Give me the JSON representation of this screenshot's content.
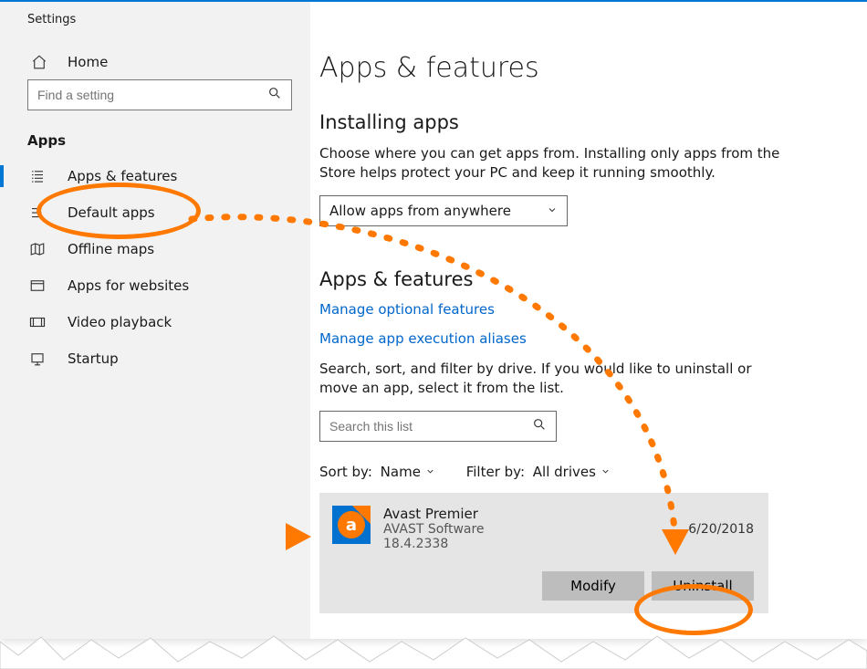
{
  "app_title": "Settings",
  "sidebar": {
    "home_label": "Home",
    "search_placeholder": "Find a setting",
    "section_label": "Apps",
    "items": [
      {
        "label": "Apps & features"
      },
      {
        "label": "Default apps"
      },
      {
        "label": "Offline maps"
      },
      {
        "label": "Apps for websites"
      },
      {
        "label": "Video playback"
      },
      {
        "label": "Startup"
      }
    ]
  },
  "page": {
    "title": "Apps & features",
    "install_section": {
      "title": "Installing apps",
      "desc": "Choose where you can get apps from. Installing only apps from the Store helps protect your PC and keep it running smoothly.",
      "dropdown_value": "Allow apps from anywhere"
    },
    "features_section": {
      "title": "Apps & features",
      "link1": "Manage optional features",
      "link2": "Manage app execution aliases",
      "desc": "Search, sort, and filter by drive. If you would like to uninstall or move an app, select it from the list.",
      "search_placeholder": "Search this list",
      "sort_label": "Sort by:",
      "sort_value": "Name",
      "filter_label": "Filter by:",
      "filter_value": "All drives"
    },
    "app_row": {
      "name": "Avast Premier",
      "vendor": "AVAST Software",
      "version": "18.4.2338",
      "date": "6/20/2018",
      "modify": "Modify",
      "uninstall": "Uninstall"
    }
  }
}
